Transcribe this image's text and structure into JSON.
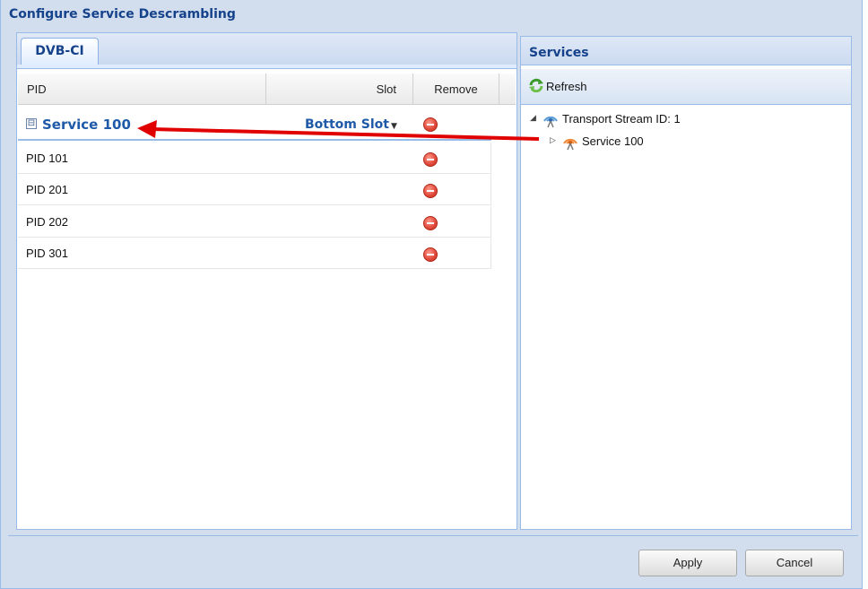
{
  "window": {
    "title": "Configure Service Descrambling"
  },
  "tabs": [
    {
      "label": "DVB-CI"
    }
  ],
  "grid": {
    "columns": {
      "pid": "PID",
      "slot": "Slot",
      "remove": "Remove"
    },
    "service": {
      "toggle": "⊟",
      "name": "Service 100",
      "slot": "Bottom Slot"
    },
    "pids": [
      "PID 101",
      "PID 201",
      "PID 202",
      "PID 301"
    ]
  },
  "services_panel": {
    "title": "Services",
    "refresh_label": "Refresh",
    "tree": {
      "root": "Transport Stream ID: 1",
      "child": "Service 100"
    }
  },
  "buttons": {
    "apply": "Apply",
    "cancel": "Cancel"
  },
  "colors": {
    "accent": "#15428b",
    "annotation_arrow": "#e00000",
    "border": "#99bbe8"
  }
}
